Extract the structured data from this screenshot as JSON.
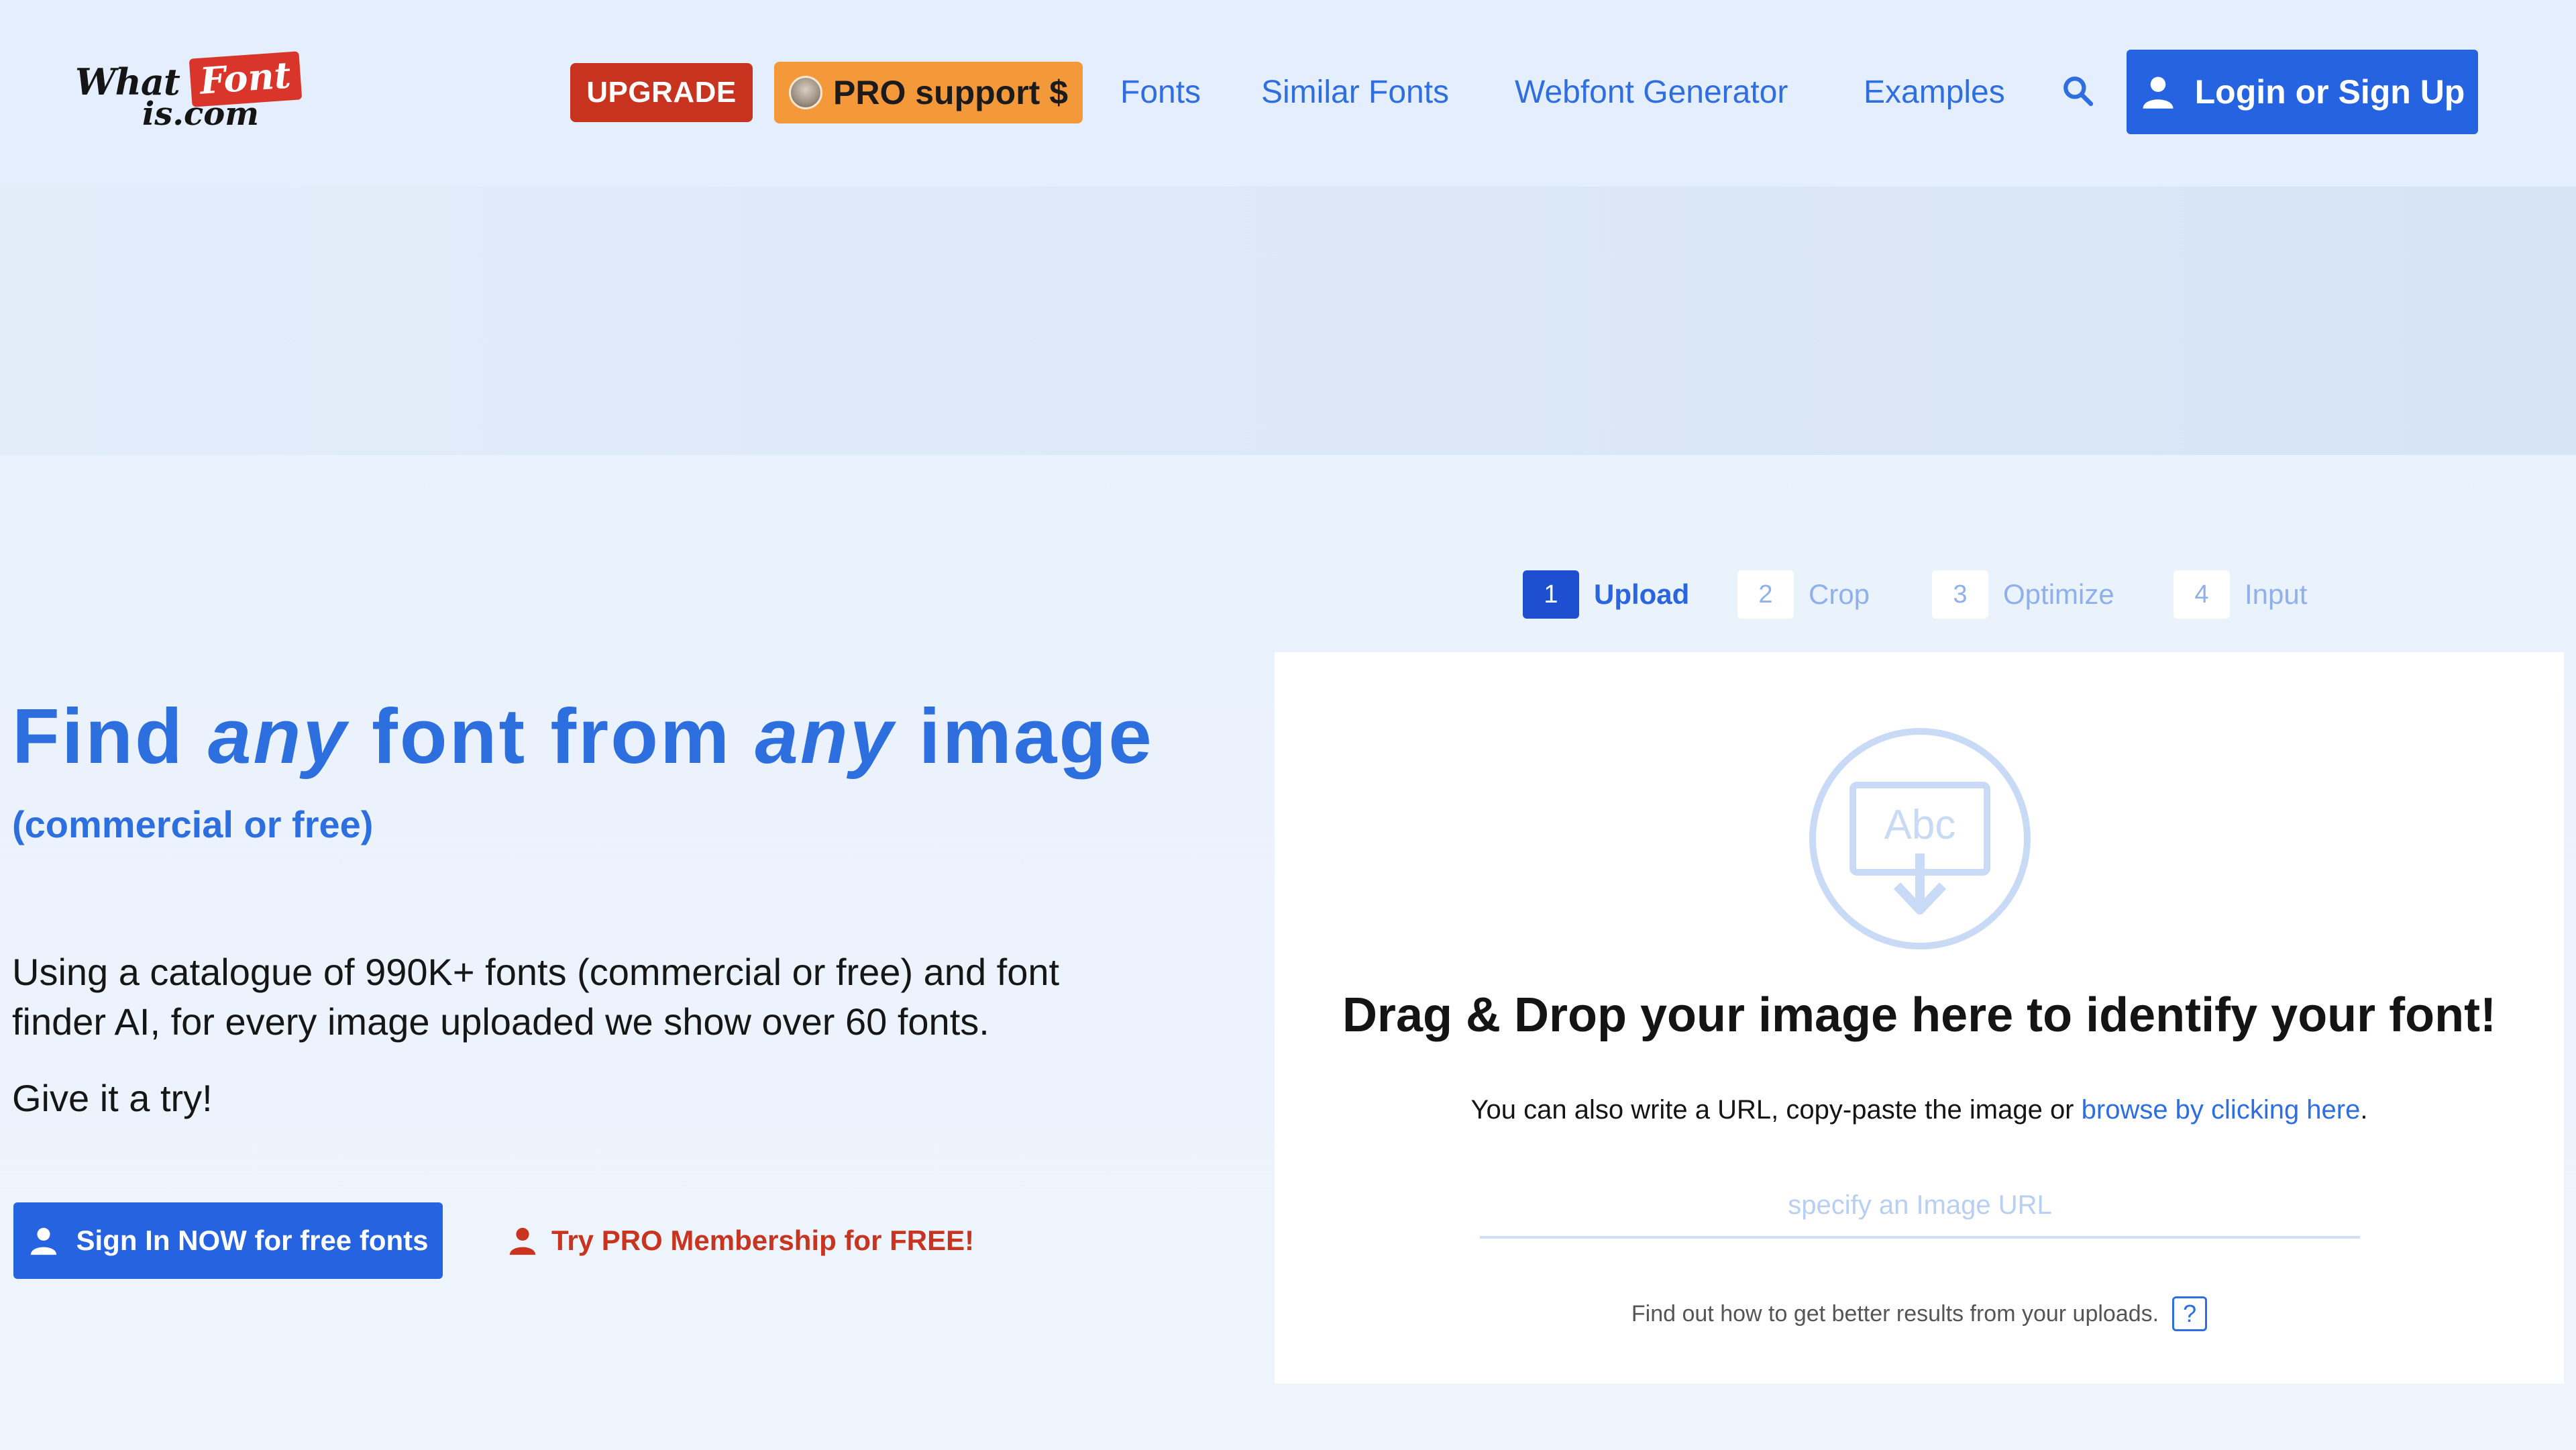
{
  "header": {
    "logo": {
      "what": "What",
      "font": "Font",
      "iscom": "is.com"
    },
    "upgrade_label": "UPGRADE",
    "pro_support_label": "PRO support $",
    "nav": [
      "Fonts",
      "Similar Fonts",
      "Webfont Generator",
      "Examples"
    ],
    "search_icon": "search-icon",
    "login_label": "Login or Sign Up"
  },
  "hero": {
    "title_parts": [
      "Find",
      "any",
      "font from",
      "any",
      "image"
    ],
    "subtitle": "(commercial or free)",
    "description": "Using a catalogue of 990K+ fonts (commercial or free) and font finder AI, for every image uploaded we show over 60 fonts.",
    "try_text": "Give it a try!",
    "signin_label": "Sign In NOW for free fonts",
    "pro_trial_label": "Try PRO Membership for FREE!"
  },
  "steps": [
    {
      "num": "1",
      "label": "Upload",
      "active": true
    },
    {
      "num": "2",
      "label": "Crop",
      "active": false
    },
    {
      "num": "3",
      "label": "Optimize",
      "active": false
    },
    {
      "num": "4",
      "label": "Input",
      "active": false
    }
  ],
  "upload": {
    "icon_text": "Abc",
    "title": "Drag & Drop your image here to identify your font!",
    "hint_prefix": "You can also write a URL, copy-paste the image or ",
    "hint_link": "browse by clicking here",
    "hint_suffix": ".",
    "url_placeholder": "specify an Image URL",
    "tip_text": "Find out how to get better results from your uploads.",
    "tip_icon": "?"
  },
  "colors": {
    "accent": "#2563e0",
    "upgrade": "#c83320",
    "pro": "#f4993a",
    "link_red": "#c8341f"
  }
}
